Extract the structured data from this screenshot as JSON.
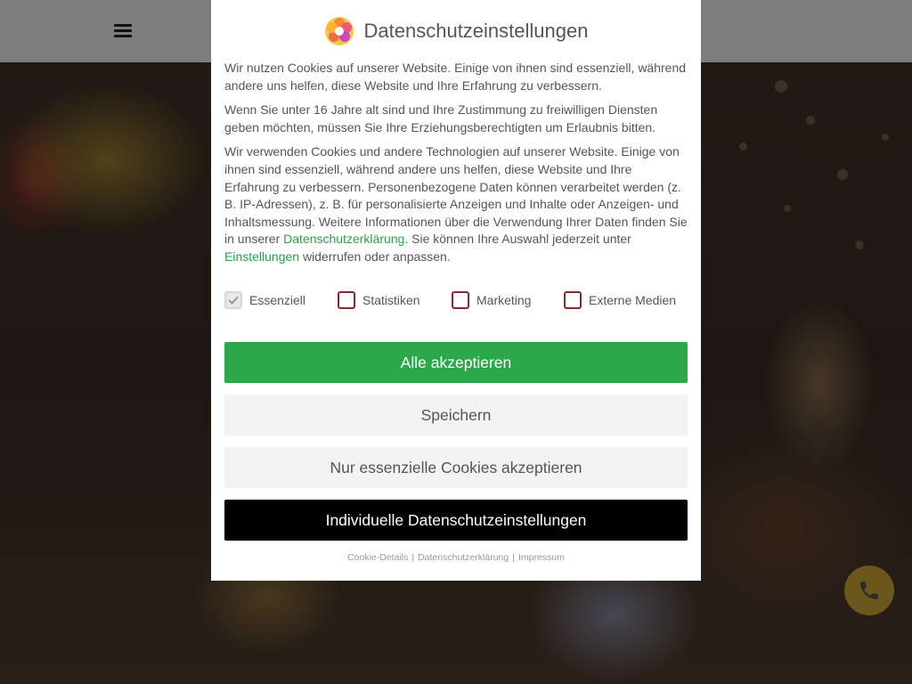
{
  "header": {
    "menu_icon": "hamburger-menu-icon"
  },
  "modal": {
    "title": "Datenschutzeinstellungen",
    "logo_icon": "flower-logo-icon",
    "paragraphs": {
      "p1": "Wir nutzen Cookies auf unserer Website. Einige von ihnen sind essenziell, während andere uns helfen, diese Website und Ihre Erfahrung zu verbessern.",
      "p2": "Wenn Sie unter 16 Jahre alt sind und Ihre Zustimmung zu freiwilligen Diensten geben möchten, müssen Sie Ihre Erziehungsberechtigten um Erlaubnis bitten.",
      "p3_part1": "Wir verwenden Cookies und andere Technologien auf unserer Website. Einige von ihnen sind essenziell, während andere uns helfen, diese Website und Ihre Erfahrung zu verbessern. Personenbezogene Daten können verarbeitet werden (z. B. IP-Adressen), z. B. für personalisierte Anzeigen und Inhalte oder Anzeigen- und Inhaltsmessung. Weitere Informationen über die Verwendung Ihrer Daten finden Sie in unserer ",
      "p3_link1": "Datenschutzerklärung",
      "p3_part2": ". Sie können Ihre Auswahl jederzeit unter ",
      "p3_link2": "Einstellungen",
      "p3_part3": " widerrufen oder anpassen."
    },
    "checkboxes": [
      {
        "label": "Essenziell",
        "checked": true
      },
      {
        "label": "Statistiken",
        "checked": false
      },
      {
        "label": "Marketing",
        "checked": false
      },
      {
        "label": "Externe Medien",
        "checked": false
      }
    ],
    "buttons": {
      "accept_all": "Alle akzeptieren",
      "save": "Speichern",
      "essential_only": "Nur essenzielle Cookies akzeptieren",
      "individual": "Individuelle Datenschutzeinstellungen"
    },
    "footer": {
      "cookie_details": "Cookie-Details",
      "privacy": "Datenschutzerklärung",
      "imprint": "Impressum",
      "separator": "|"
    }
  },
  "floating": {
    "call_icon": "phone-icon"
  },
  "colors": {
    "accent_green": "#2aa84a",
    "link_green": "#2aa04a",
    "dark_button": "#000000",
    "call_button": "#6b561b",
    "checkbox_border": "#8a2a2a"
  }
}
